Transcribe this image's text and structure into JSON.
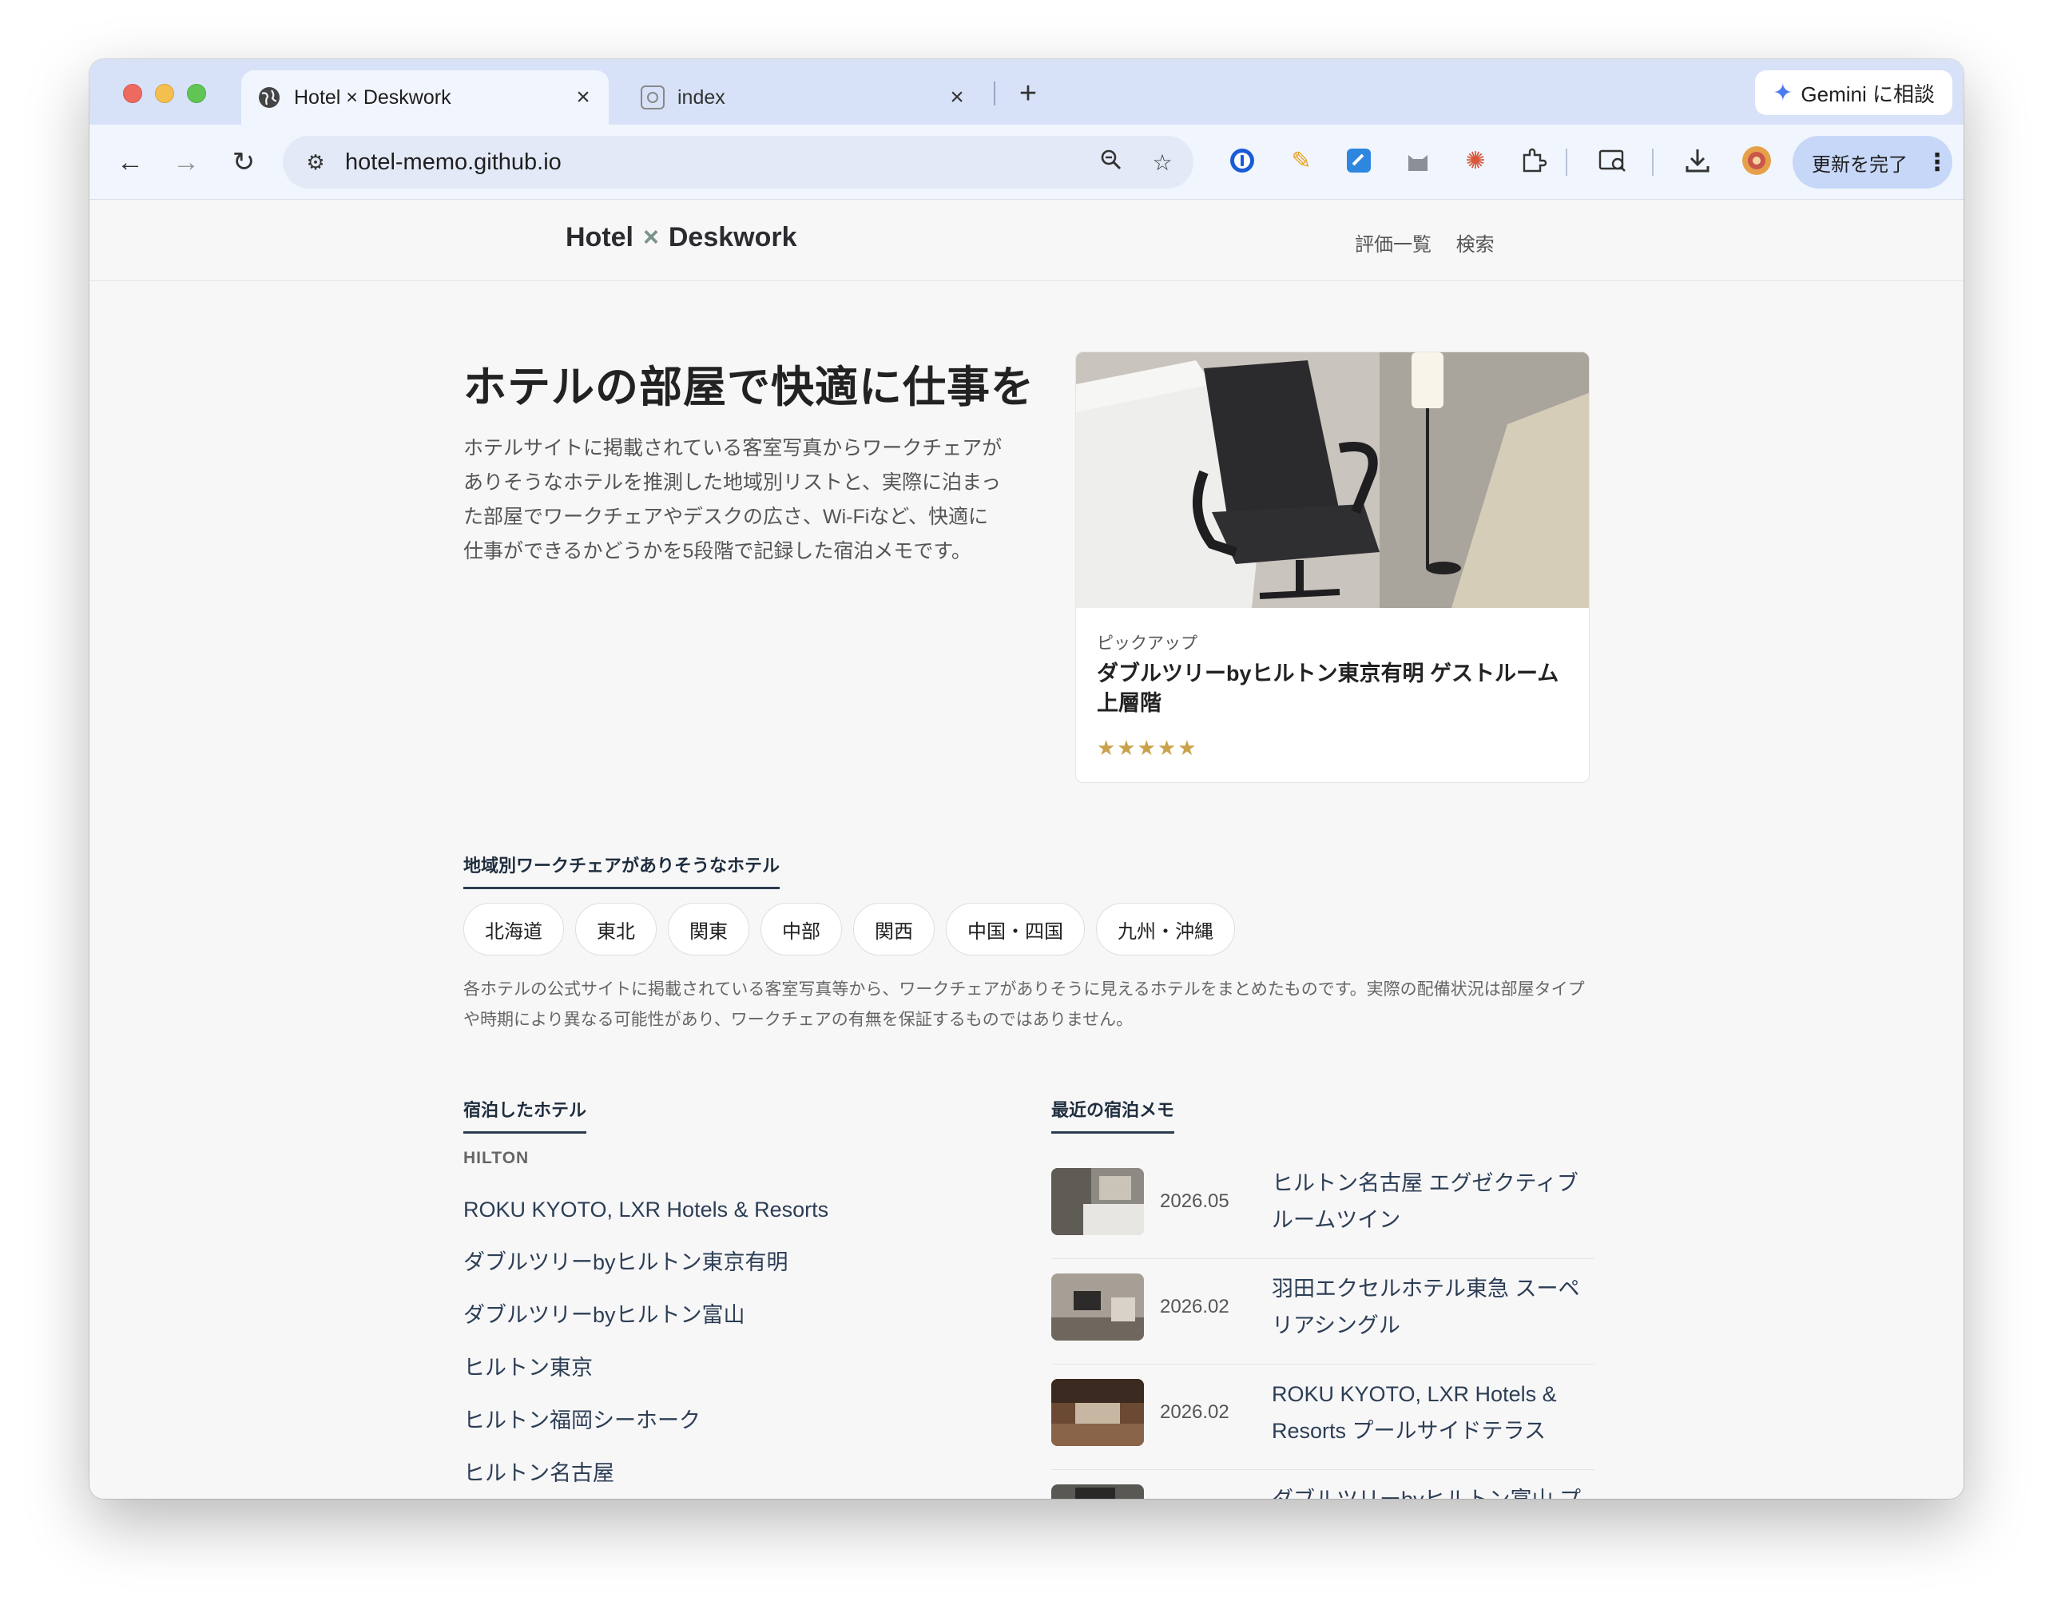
{
  "browser": {
    "tabs": [
      {
        "title": "Hotel × Deskwork",
        "active": true
      },
      {
        "title": "index",
        "active": false
      }
    ],
    "close_glyph": "×",
    "new_tab_glyph": "+",
    "gemini_label": "Gemini に相談",
    "url": "hotel-memo.github.io",
    "update_label": "更新を完了"
  },
  "site": {
    "logo_left": "Hotel",
    "logo_x": "×",
    "logo_right": "Deskwork",
    "nav": [
      "評価一覧",
      "検索"
    ]
  },
  "hero": {
    "title": "ホテルの部屋で快適に仕事を",
    "description": "ホテルサイトに掲載されている客室写真からワークチェアがありそうなホテルを推測した地域別リストと、実際に泊まった部屋でワークチェアやデスクの広さ、Wi-Fiなど、快適に仕事ができるかどうかを5段階で記録した宿泊メモです。"
  },
  "pickup": {
    "label": "ピックアップ",
    "title": "ダブルツリーbyヒルトン東京有明 ゲストルーム上層階",
    "stars": "★★★★★",
    "rating": 5
  },
  "regions": {
    "heading": "地域別ワークチェアがありそうなホテル",
    "chips": [
      "北海道",
      "東北",
      "関東",
      "中部",
      "関西",
      "中国・四国",
      "九州・沖縄"
    ],
    "note": "各ホテルの公式サイトに掲載されている客室写真等から、ワークチェアがありそうに見えるホテルをまとめたものです。実際の配備状況は部屋タイプや時期により異なる可能性があり、ワークチェアの有無を保証するものではありません。"
  },
  "stayed": {
    "heading": "宿泊したホテル",
    "brand": "HILTON",
    "hotels": [
      "ROKU KYOTO, LXR Hotels & Resorts",
      "ダブルツリーbyヒルトン東京有明",
      "ダブルツリーbyヒルトン富山",
      "ヒルトン東京",
      "ヒルトン福岡シーホーク",
      "ヒルトン名古屋"
    ]
  },
  "memos": {
    "heading": "最近の宿泊メモ",
    "items": [
      {
        "date": "2026.05",
        "title": "ヒルトン名古屋 エグゼクティブルームツイン"
      },
      {
        "date": "2026.02",
        "title": "羽田エクセルホテル東急 スーペリアシングル"
      },
      {
        "date": "2026.02",
        "title": "ROKU KYOTO, LXR Hotels & Resorts プールサイドテラス"
      },
      {
        "date": "",
        "title": "ダブルツリーbyヒルトン富山 プレ"
      }
    ]
  },
  "colors": {
    "tabbar": "#d7e2f8",
    "toolbar": "#f1f5fd",
    "page_bg": "#f8f7f8",
    "link": "#2c3e55",
    "star": "#c9a24a",
    "heading_underline": "#2b3c4f"
  },
  "icons": [
    "globe-icon",
    "back-arrow-icon",
    "forward-arrow-icon",
    "reload-icon",
    "site-settings-icon",
    "zoom-icon",
    "bookmark-star-icon",
    "extensions-icon",
    "download-icon",
    "menu-dots-icon"
  ]
}
